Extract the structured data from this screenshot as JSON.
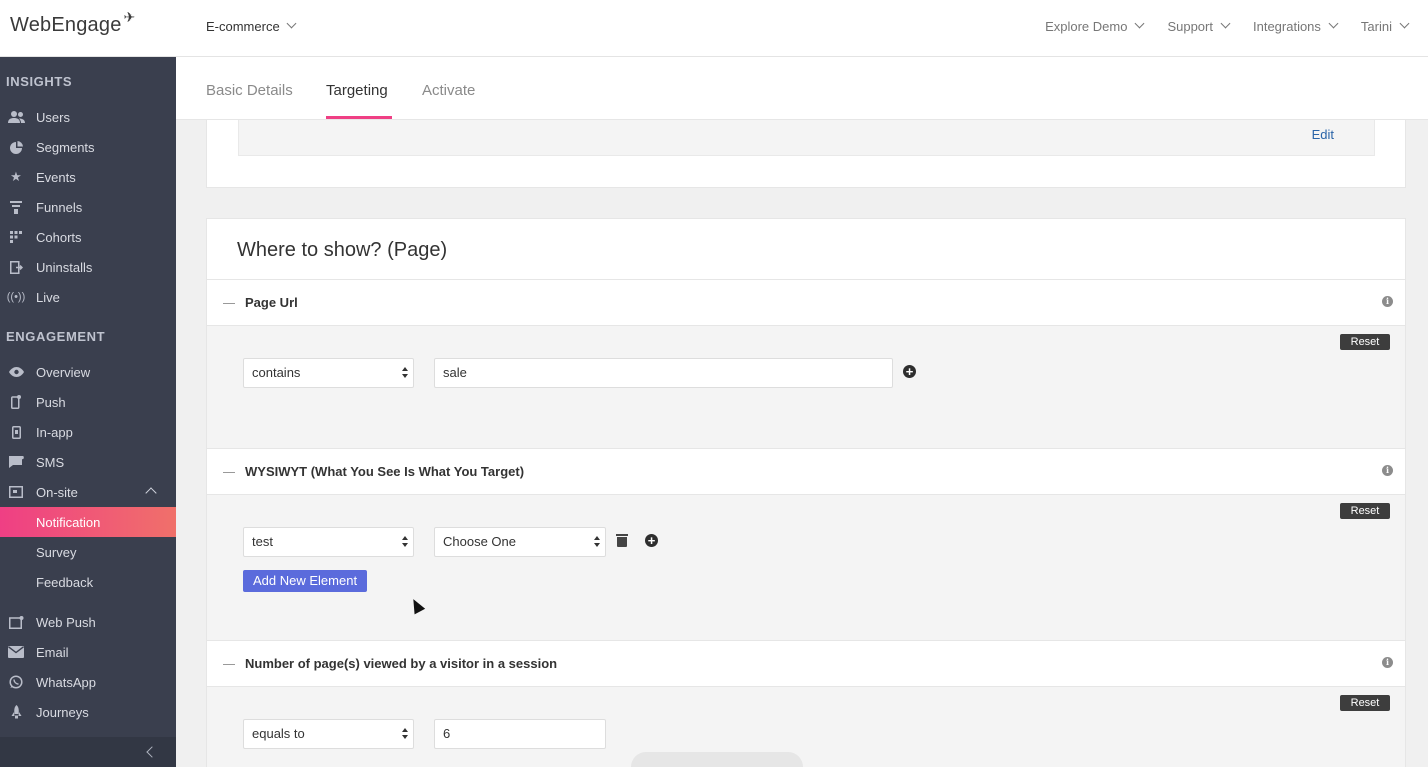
{
  "header": {
    "logo_text": "WebEngage",
    "project": "E-commerce",
    "nav": [
      "Explore Demo",
      "Support",
      "Integrations",
      "Tarini"
    ]
  },
  "sidebar": {
    "insights_label": "INSIGHTS",
    "insights": [
      {
        "label": "Users",
        "icon": "users-icon"
      },
      {
        "label": "Segments",
        "icon": "pie-chart-icon"
      },
      {
        "label": "Events",
        "icon": "star-icon"
      },
      {
        "label": "Funnels",
        "icon": "funnel-icon"
      },
      {
        "label": "Cohorts",
        "icon": "grid-icon"
      },
      {
        "label": "Uninstalls",
        "icon": "exit-icon"
      },
      {
        "label": "Live",
        "icon": "broadcast-icon"
      }
    ],
    "engagement_label": "ENGAGEMENT",
    "engagement": [
      {
        "label": "Overview",
        "icon": "eye-icon"
      },
      {
        "label": "Push",
        "icon": "mobile-push-icon"
      },
      {
        "label": "In-app",
        "icon": "mobile-icon"
      },
      {
        "label": "SMS",
        "icon": "chat-icon"
      },
      {
        "label": "On-site",
        "icon": "window-icon"
      },
      {
        "label": "Notification",
        "icon": ""
      },
      {
        "label": "Survey",
        "icon": ""
      },
      {
        "label": "Feedback",
        "icon": ""
      },
      {
        "label": "Web Push",
        "icon": "web-push-icon"
      },
      {
        "label": "Email",
        "icon": "envelope-icon"
      },
      {
        "label": "WhatsApp",
        "icon": "whatsapp-icon"
      },
      {
        "label": "Journeys",
        "icon": "rocket-icon"
      }
    ]
  },
  "tabs": [
    "Basic Details",
    "Targeting",
    "Activate"
  ],
  "top_card": {
    "edit_label": "Edit"
  },
  "where_card": {
    "title": "Where to show? (Page)",
    "sections": [
      {
        "title": "Page Url",
        "reset": "Reset",
        "operator": "contains",
        "value": "sale"
      },
      {
        "title": "WYSIWYT (What You See Is What You Target)",
        "reset": "Reset",
        "element": "test",
        "choice": "Choose One",
        "add_button": "Add New Element"
      },
      {
        "title": "Number of page(s) viewed by a visitor in a session",
        "reset": "Reset",
        "operator": "equals to",
        "value": "6"
      }
    ]
  }
}
